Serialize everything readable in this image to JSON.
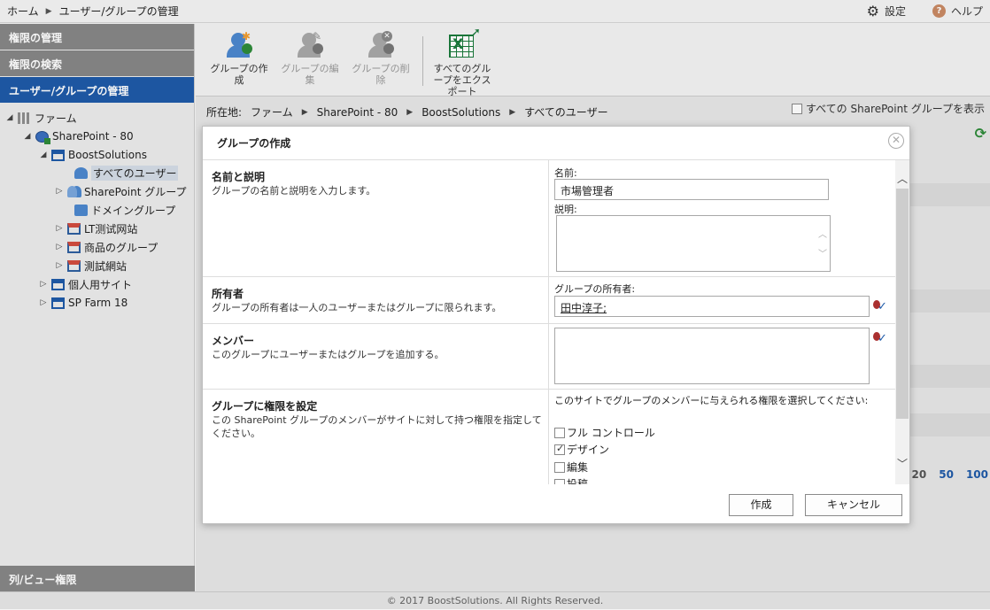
{
  "topbar": {
    "home": "ホーム",
    "page": "ユーザー/グループの管理",
    "settings": "設定",
    "help": "ヘルプ"
  },
  "sidebar": {
    "nav": [
      "権限の管理",
      "権限の検索",
      "ユーザー/グループの管理"
    ],
    "bottom": "列/ビュー権限",
    "tree": {
      "farm": "ファーム",
      "sp80": "SharePoint - 80",
      "boost": "BoostSolutions",
      "all_users": "すべてのユーザー",
      "sp_groups": "SharePoint グループ",
      "domain_groups": "ドメイングループ",
      "lt_site": "LT测试网站",
      "product_groups": "商品のグループ",
      "test_site": "測試網站",
      "personal": "個人用サイト",
      "farm18": "SP Farm 18"
    }
  },
  "ribbon": {
    "create_group": "グループの作成",
    "edit_group": "グループの編集",
    "delete_group": "グループの削除",
    "export_groups": "すべてのグループをエクスポート"
  },
  "location": {
    "label": "所在地:",
    "path": [
      "ファーム",
      "SharePoint - 80",
      "BoostSolutions",
      "すべてのユーザー"
    ],
    "show_all": "すべての SharePoint グループを表示"
  },
  "pager": {
    "current": "20",
    "options": [
      "50",
      "100"
    ]
  },
  "footer": "© 2017 BoostSolutions. All Rights Reserved.",
  "dialog": {
    "title": "グループの作成",
    "name_section": {
      "heading": "名前と説明",
      "desc": "グループの名前と説明を入力します。",
      "name_label": "名前:",
      "name_value": "市場管理者",
      "desc_label": "説明:"
    },
    "owner_section": {
      "heading": "所有者",
      "desc": "グループの所有者は一人のユーザーまたはグループに限られます。",
      "owner_label": "グループの所有者:",
      "owner_value": "田中淳子;"
    },
    "member_section": {
      "heading": "メンバー",
      "desc": "このグループにユーザーまたはグループを追加する。"
    },
    "perm_section": {
      "heading": "グループに権限を設定",
      "desc": "この SharePoint グループのメンバーがサイトに対して持つ権限を指定してください。",
      "prompt": "このサイトでグループのメンバーに与えられる権限を選択してください:",
      "options": [
        {
          "label": "フル コントロール",
          "checked": false
        },
        {
          "label": "デザイン",
          "checked": true
        },
        {
          "label": "編集",
          "checked": false
        },
        {
          "label": "投稿",
          "checked": false
        }
      ]
    },
    "create_btn": "作成",
    "cancel_btn": "キャンセル"
  },
  "colors": {
    "accent": "#1f5aa8",
    "nav_grey": "#878787",
    "excel_green": "#1b7a3c"
  }
}
